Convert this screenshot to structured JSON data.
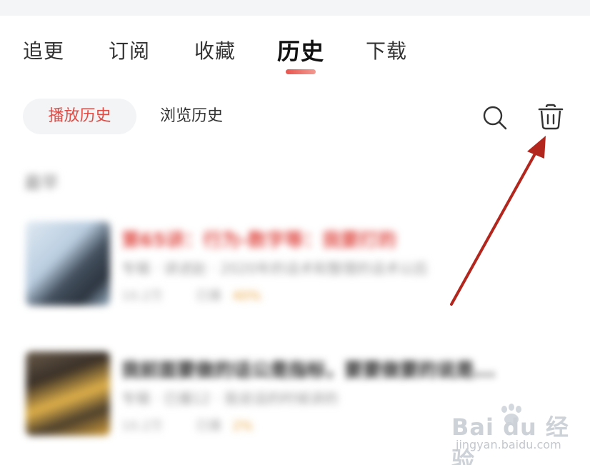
{
  "tabs": [
    {
      "label": "追更"
    },
    {
      "label": "订阅"
    },
    {
      "label": "收藏"
    },
    {
      "label": "历史"
    },
    {
      "label": "下载"
    }
  ],
  "active_tab": "历史",
  "subtabs": [
    {
      "label": "播放历史"
    },
    {
      "label": "浏览历史"
    }
  ],
  "icons": {
    "search": "search-icon",
    "delete": "trash-icon"
  },
  "history": {
    "section_label": "最早",
    "items": [
      {
        "title": "第65讲：行为-数字等：我要打的",
        "subtitle": "专辑 · 讲述赵 · 2020年的话术和整理的话术以后",
        "meta_plays": "10.2万",
        "meta_date": "已播",
        "meta_badge": "40%"
      },
      {
        "title": "我前面要做的话公是指标，要要做要的说是...",
        "subtitle": "专辑 · 已播12 · 我说话的时候讲的",
        "meta_plays": "10.2万",
        "meta_date": "已播",
        "meta_badge": "2%"
      }
    ]
  },
  "watermark": {
    "brand": "Bai du 经验",
    "url": "jingyan.baidu.com"
  },
  "colors": {
    "accent": "#e04b45",
    "annotation_arrow": "#b3261e"
  }
}
